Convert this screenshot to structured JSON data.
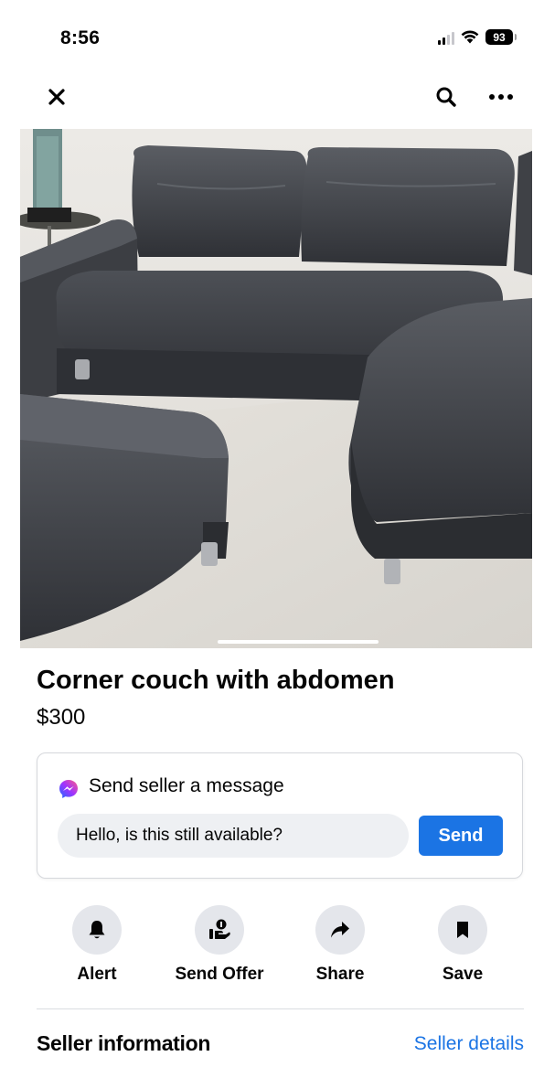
{
  "status_bar": {
    "time": "8:56",
    "battery": "93",
    "icons": [
      "signal-icon",
      "wifi-icon",
      "battery-icon"
    ]
  },
  "nav": {
    "icons": [
      "close-icon",
      "search-icon",
      "more-icon"
    ]
  },
  "listing": {
    "title": "Corner couch with abdomen",
    "price": "$300"
  },
  "message_card": {
    "heading": "Send seller a message",
    "input_value": "Hello, is this still available?",
    "send_label": "Send"
  },
  "actions": [
    {
      "label": "Alert",
      "icon": "bell-icon"
    },
    {
      "label": "Send Offer",
      "icon": "offer-icon"
    },
    {
      "label": "Share",
      "icon": "share-arrow-icon"
    },
    {
      "label": "Save",
      "icon": "bookmark-icon"
    }
  ],
  "seller": {
    "heading": "Seller information",
    "details_link": "Seller details"
  },
  "colors": {
    "accent": "#1b74e4",
    "action_bg": "#e4e6eb",
    "input_bg": "#eef0f3",
    "text": "#050505"
  }
}
